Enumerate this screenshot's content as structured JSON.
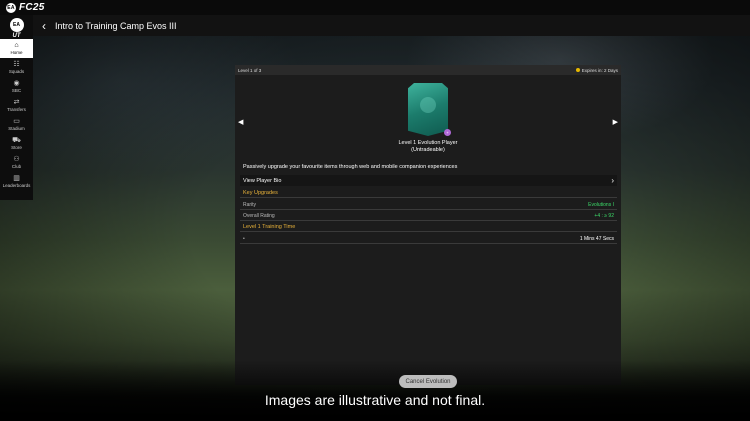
{
  "app": {
    "logo_text": "FC25",
    "ea_badge": "EA",
    "ut_badge": "EA",
    "ut_label": "UT"
  },
  "header": {
    "title": "Intro to Training Camp Evos III",
    "back_icon": "chevron-left-icon"
  },
  "sidebar": {
    "items": [
      {
        "label": "Home",
        "icon": "home-icon",
        "glyph": "⌂",
        "active": true
      },
      {
        "label": "Squads",
        "icon": "squads-icon",
        "glyph": "☷",
        "active": false
      },
      {
        "label": "SBC",
        "icon": "sbc-icon",
        "glyph": "◉",
        "active": false
      },
      {
        "label": "Transfers",
        "icon": "transfers-icon",
        "glyph": "⇄",
        "active": false
      },
      {
        "label": "Stadium",
        "icon": "stadium-icon",
        "glyph": "▭",
        "active": false
      },
      {
        "label": "Store",
        "icon": "store-icon",
        "glyph": "⛟",
        "active": false
      },
      {
        "label": "Club",
        "icon": "club-icon",
        "glyph": "⚇",
        "active": false
      },
      {
        "label": "Leaderboards",
        "icon": "leaderboards-icon",
        "glyph": "▥",
        "active": false
      }
    ]
  },
  "panel": {
    "level": "Level 1 of 3",
    "expires": "Expires in: 2 Days",
    "prev_arrow": "◀",
    "next_arrow": "▶",
    "card_title_line1": "Level 1 Evolution Player",
    "card_title_line2": "(Untradeable)",
    "evo_badge": "+",
    "description": "Passively upgrade your favourite items through web and mobile companion experiences",
    "view_bio": "View Player Bio",
    "view_bio_chevron": "›",
    "key_upgrades": "Key Upgrades",
    "rarity_label": "Rarity",
    "rarity_value": "Evolutions I",
    "ovr_label": "Overall Rating",
    "ovr_value": "+4 : ≥ 92",
    "training_time_title": "Level 1 Training Time",
    "time_label": "•",
    "time_value": "1 Mins 47 Secs"
  },
  "actions": {
    "cancel": "Cancel Evolution"
  },
  "footer": {
    "disclaimer": "Images are illustrative and not final."
  },
  "colors": {
    "accent": "#e8b23a",
    "green": "#3ddc6a",
    "card": "#1c7c6c",
    "evo": "#b06ad8"
  }
}
